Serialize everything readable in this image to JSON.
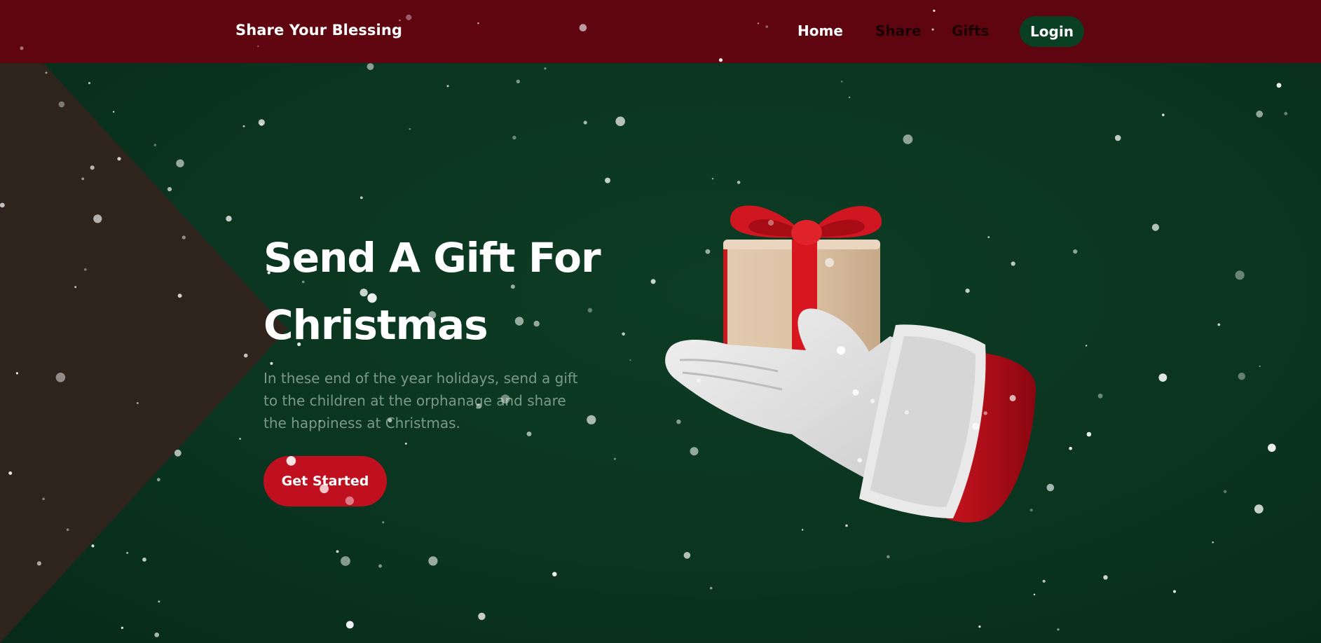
{
  "navbar": {
    "brand": "Share Your Blessing",
    "links": [
      {
        "label": "Home"
      },
      {
        "label": "Share"
      },
      {
        "label": "Gifts"
      }
    ],
    "login_label": "Login"
  },
  "hero": {
    "title": "Send A Gift For Christmas",
    "description": "In these end of the year holidays, send a gift to the children at the orphanage and share the happiness at Christmas.",
    "cta_label": "Get Started"
  },
  "colors": {
    "navbar_bg": "#5e0510",
    "hero_bg": "#0a3520",
    "accent_red": "#c0101f",
    "login_bg": "#093f22",
    "wedge": "#2e241c"
  },
  "icons": {
    "illustration": "santa-hand-gift-icon",
    "background": "snowflakes-icon"
  }
}
